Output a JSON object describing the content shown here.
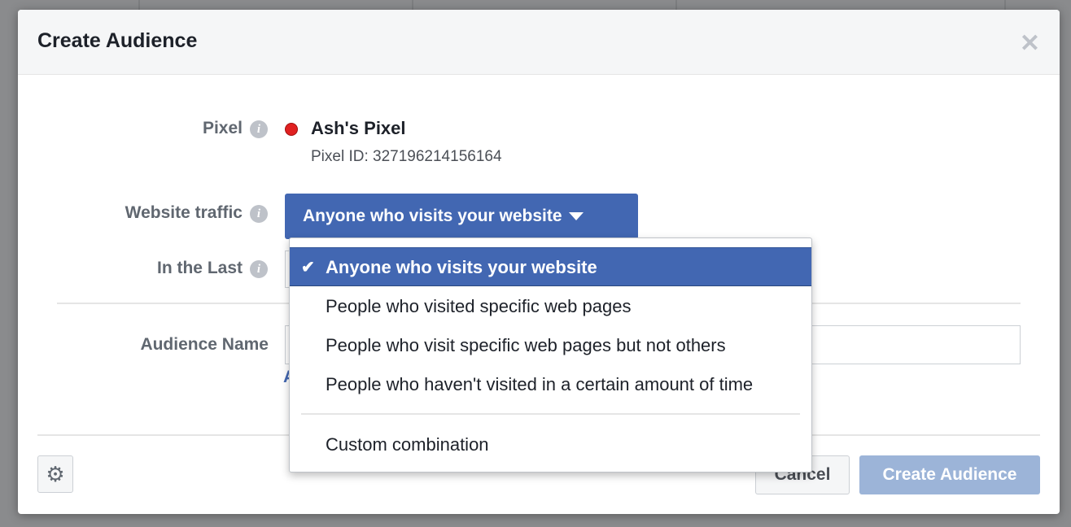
{
  "modal": {
    "title": "Create Audience",
    "close_icon": "close-icon"
  },
  "form": {
    "pixel_label": "Pixel",
    "pixel_name": "Ash's Pixel",
    "pixel_status_color": "#e02020",
    "pixel_id": "Pixel ID: 327196214156164",
    "website_traffic_label": "Website traffic",
    "website_traffic_value": "Anyone who visits your website",
    "in_the_last_label": "In the Last",
    "audience_name_label": "Audience Name",
    "audience_name_value": "",
    "add_description_link": "A"
  },
  "dropdown": {
    "items": [
      {
        "label": "Anyone who visits your website",
        "selected": true
      },
      {
        "label": "People who visited specific web pages"
      },
      {
        "label": "People who visit specific web pages but not others"
      },
      {
        "label": "People who haven't visited in a certain amount of time"
      },
      {
        "label": "Custom combination"
      }
    ]
  },
  "footer": {
    "settings_icon": "gear-icon",
    "cancel_label": "Cancel",
    "create_label": "Create Audience"
  },
  "colors": {
    "accent": "#4267b2",
    "disabled_button": "#9cb4d8"
  }
}
